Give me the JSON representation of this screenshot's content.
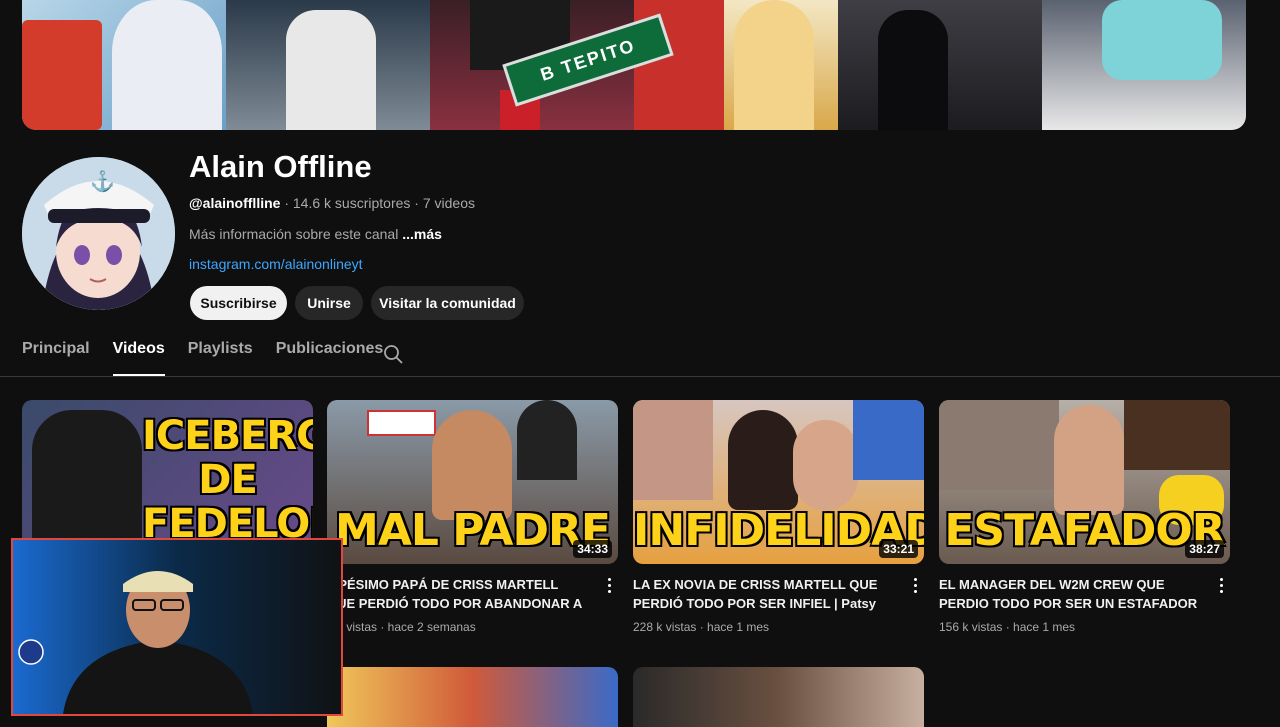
{
  "channel": {
    "name": "Alain Offline",
    "handle": "@alainofflline",
    "subscribers": "14.6 k suscriptores",
    "videos_count": "7 videos",
    "description": "Más información sobre este canal",
    "more_label": "...más",
    "link": "instagram.com/alainonlineyt"
  },
  "banner": {
    "sign_text": "B TEPITO"
  },
  "buttons": {
    "subscribe": "Suscribirse",
    "join": "Unirse",
    "community": "Visitar la comunidad"
  },
  "tabs": [
    {
      "label": "Principal",
      "active": false
    },
    {
      "label": "Videos",
      "active": true
    },
    {
      "label": "Playlists",
      "active": false
    },
    {
      "label": "Publicaciones",
      "active": false
    }
  ],
  "videos": [
    {
      "thumb_text": "ICEBERG DE FEDELOBO",
      "duration": "",
      "title": "",
      "meta": ""
    },
    {
      "thumb_text": "MAL PADRE",
      "duration": "34:33",
      "title": "L PÉSIMO PAPÁ DE CRISS MARTELL QUE PERDIÓ TODO POR ABANDONAR A SU...",
      "meta": "1 k vistas · hace 2 semanas"
    },
    {
      "thumb_text": "INFIDELIDAD",
      "duration": "33:21",
      "title": "LA EX NOVIA DE CRISS MARTELL QUE PERDIÓ TODO POR SER INFIEL | Patsy",
      "meta": "228 k vistas · hace 1 mes"
    },
    {
      "thumb_text": "ESTAFADOR",
      "duration": "38:27",
      "title": "EL MANAGER DEL W2M CREW QUE PERDIO TODO POR SER UN ESTAFADOR",
      "meta": "156 k vistas · hace 1 mes"
    }
  ],
  "colors": {
    "accent": "#3ea6ff",
    "thumb_text": "#ffd21a",
    "webcam_border": "#e0483b"
  },
  "icons": {
    "search": "search-icon",
    "more": "kebab-menu-icon",
    "anchor": "anchor-icon"
  }
}
